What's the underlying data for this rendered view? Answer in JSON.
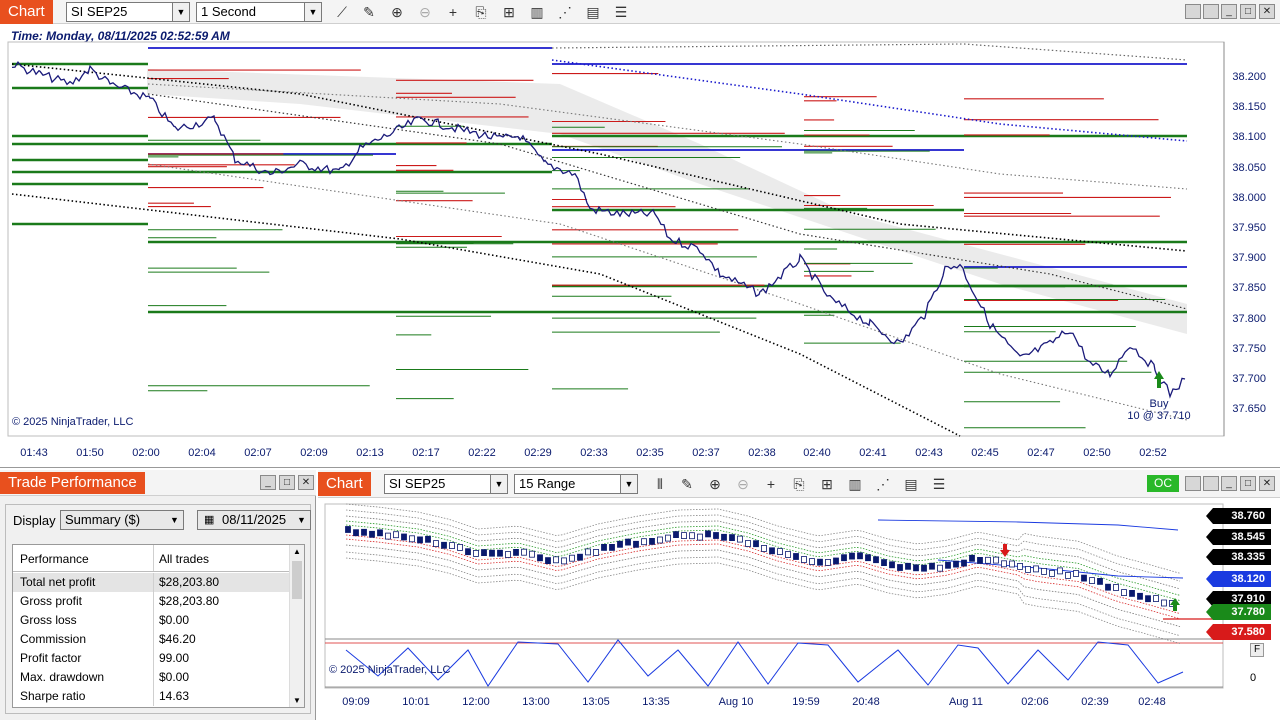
{
  "top_chart": {
    "title": "Chart",
    "instrument": "SI SEP25",
    "interval": "1 Second",
    "time_label": "Time: Monday, 08/11/2025 02:52:59 AM",
    "copyright": "© 2025 NinjaTrader, LLC",
    "price_labels": [
      "38.200",
      "38.150",
      "38.100",
      "38.050",
      "38.000",
      "37.950",
      "37.900",
      "37.850",
      "37.800",
      "37.750",
      "37.700",
      "37.650"
    ],
    "time_ticks": [
      "01:43",
      "01:50",
      "02:00",
      "02:04",
      "02:07",
      "02:09",
      "02:13",
      "02:17",
      "02:22",
      "02:29",
      "02:33",
      "02:35",
      "02:37",
      "02:38",
      "02:40",
      "02:41",
      "02:43",
      "02:45",
      "02:47",
      "02:50",
      "02:52"
    ],
    "buy_marker": {
      "line1": "Buy",
      "line2": "10 @ 37.710"
    },
    "toolbar_icons": [
      "line-icon",
      "pencil-icon",
      "zoom-in-icon",
      "zoom-out-icon",
      "crosshair-icon",
      "properties-icon",
      "strategies-icon",
      "indicators-icon",
      "templates-icon",
      "data-box-icon",
      "list-icon"
    ],
    "colors": {
      "title_bg": "#e8501e",
      "price_line": "#1a1a7a",
      "buy": "#1a8a1a",
      "sell": "#cc1a1a",
      "vwap": "#1a1acc"
    }
  },
  "perf_window": {
    "title": "Trade Performance",
    "display_label": "Display",
    "display_value": "Summary ($)",
    "date_value": "08/11/2025",
    "header_col1": "Performance",
    "header_col2": "All trades",
    "rows": [
      {
        "label": "Total net profit",
        "value": "$28,203.80"
      },
      {
        "label": "Gross profit",
        "value": "$28,203.80"
      },
      {
        "label": "Gross loss",
        "value": "$0.00"
      },
      {
        "label": "Commission",
        "value": "$46.20"
      },
      {
        "label": "Profit factor",
        "value": "99.00"
      },
      {
        "label": "Max. drawdown",
        "value": "$0.00"
      },
      {
        "label": "Sharpe ratio",
        "value": "14.63"
      }
    ]
  },
  "bottom_chart": {
    "title": "Chart",
    "instrument": "SI SEP25",
    "interval": "15 Range",
    "oc_badge": "OC",
    "copyright": "© 2025 NinjaTrader, LLC",
    "price_tags": [
      {
        "text": "38.760",
        "color": "#000000"
      },
      {
        "text": "38.545",
        "color": "#000000"
      },
      {
        "text": "38.335",
        "color": "#000000"
      },
      {
        "text": "38.120",
        "color": "#1a3ae0"
      },
      {
        "text": "37.910",
        "color": "#000000"
      },
      {
        "text": "37.780",
        "color": "#1a8a1a"
      },
      {
        "text": "37.580",
        "color": "#d81a1a"
      }
    ],
    "osc_label": "0",
    "time_ticks": [
      "09:09",
      "10:01",
      "12:00",
      "13:00",
      "13:05",
      "13:35",
      "Aug 10",
      "19:59",
      "20:48",
      "Aug 11",
      "02:06",
      "02:39",
      "02:48"
    ]
  }
}
